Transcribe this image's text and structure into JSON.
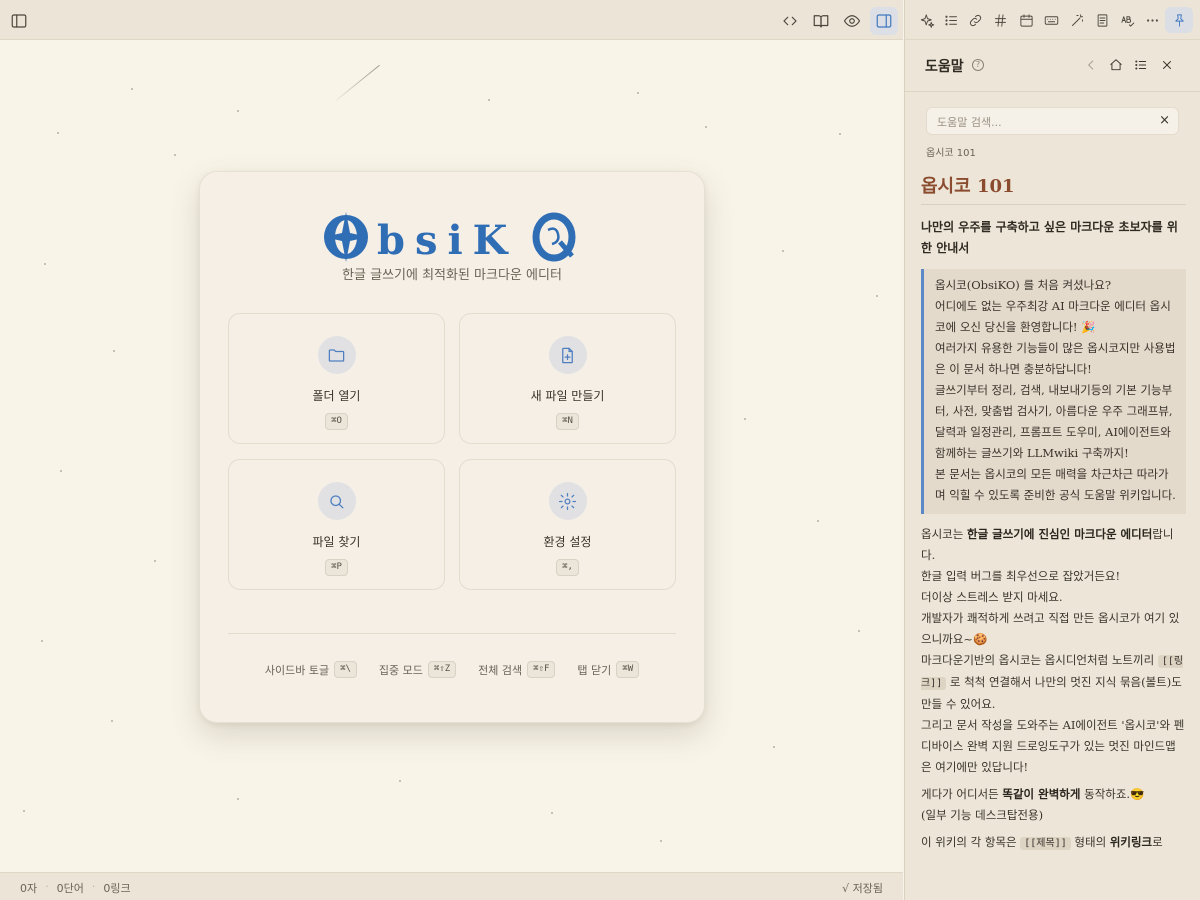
{
  "app": {
    "logo_text": "ObsiKO",
    "subtitle": "한글 글쓰기에 최적화된 마크다운 에디터"
  },
  "left_toolbar": {
    "icons": [
      "sidebar-toggle-icon",
      "code-icon",
      "book-open-icon",
      "eye-icon",
      "panel-right-icon"
    ]
  },
  "welcome": {
    "tiles": [
      {
        "label": "폴더 열기",
        "shortcut": "⌘O",
        "icon": "folder-icon"
      },
      {
        "label": "새 파일 만들기",
        "shortcut": "⌘N",
        "icon": "file-plus-icon"
      },
      {
        "label": "파일 찾기",
        "shortcut": "⌘P",
        "icon": "search-icon"
      },
      {
        "label": "환경 설정",
        "shortcut": "⌘,",
        "icon": "gear-icon"
      }
    ],
    "shortcuts": [
      {
        "label": "사이드바 토글",
        "key": "⌘\\"
      },
      {
        "label": "집중 모드",
        "key": "⌘⇧Z"
      },
      {
        "label": "전체 검색",
        "key": "⌘⇧F"
      },
      {
        "label": "탭 닫기",
        "key": "⌘W"
      }
    ]
  },
  "statusbar": {
    "chars": "0자",
    "words": "0단어",
    "links": "0링크",
    "saved": "√ 저장됨"
  },
  "right_toolbar": {
    "icons": [
      "sparkle-icon",
      "list-icon",
      "link-icon",
      "hash-icon",
      "calendar-icon",
      "keyboard-icon",
      "magic-wand-icon",
      "document-icon",
      "spellcheck-icon",
      "more-icon",
      "pin-icon"
    ]
  },
  "help_panel": {
    "title": "도움말",
    "search_placeholder": "도움말 검색...",
    "breadcrumb": "옵시코 101",
    "doc_title": "옵시코 101",
    "lead": "나만의 우주를 구축하고 싶은 마크다운 초보자를 위한 안내서",
    "quote_lines": [
      "옵시코(ObsiKO) 를 처음 켜셨나요?",
      "어디에도 없는 우주최강 AI 마크다운 에디터 옵시코에 오신 당신을 환영합니다! 🎉",
      "여러가지 유용한 기능들이 많은 옵시코지만 사용법은 이 문서 하나면 충분하답니다!",
      "글쓰기부터 정리, 검색, 내보내기등의 기본 기능부터, 사전, 맞춤법 검사기, 아름다운 우주 그래프뷰, 달력과 일정관리, 프롬프트 도우미, AI에이전트와 함께하는 글쓰기와 LLMwiki 구축까지!",
      "본 문서는 옵시코의 모든 매력을 차근차근 따라가며 익힐 수 있도록 준비한 공식 도움말 위키입니다."
    ],
    "para1_pre": "옵시코는 ",
    "para1_bold": "한글 글쓰기에 진심인 마크다운 에디터",
    "para1_post": "랍니다.",
    "para2": "한글 입력 버그를 최우선으로 잡았거든요!",
    "para3": "더이상 스트레스 받지 마세요.",
    "para4": "개발자가 쾌적하게 쓰려고 직접 만든 옵시코가 여기 있으니까요~🍪",
    "para5_pre": "마크다운기반의 옵시코는 옵시디언처럼 노트끼리 ",
    "para5_code": "[[링크]]",
    "para5_post": " 로 척척 연결해서 나만의 멋진 지식 묶음(볼트)도 만들 수 있어요.",
    "para6": "그리고 문서 작성을 도와주는 AI에이전트 '옵시코'와 펜디바이스 완벽 지원 드로잉도구가 있는 멋진 마인드맵은 여기에만 있답니다!",
    "para7_pre": "게다가 어디서든 ",
    "para7_bold": "똑같이 완벽하게",
    "para7_post": " 동작하죠.😎",
    "para8": "(일부 기능 데스크탑전용)",
    "para9_pre": "이 위키의 각 항목은 ",
    "para9_code": "[[제목]]",
    "para9_mid": " 형태의 ",
    "para9_bold": "위키링크",
    "para9_post": "로"
  }
}
